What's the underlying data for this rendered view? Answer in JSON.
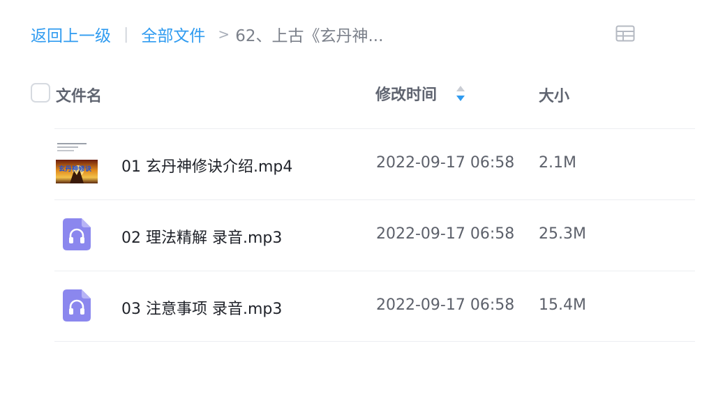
{
  "breadcrumb": {
    "back": "返回上一级",
    "divider": "|",
    "all_files": "全部文件",
    "arrow": ">",
    "current": "62、上古《玄丹神..."
  },
  "icons": {
    "view_toggle": "grid-view-icon",
    "sort": "sort-icon",
    "audio": "headphones-icon",
    "video_thumb": "video-thumbnail"
  },
  "colors": {
    "accent": "#2f9bf0",
    "audio_icon": "#8b87ee"
  },
  "header": {
    "name": "文件名",
    "time": "修改时间",
    "size": "大小"
  },
  "thumbnail": {
    "caption": "玄丹神修诀"
  },
  "files": [
    {
      "name": "01 玄丹神修诀介绍.mp4",
      "time": "2022-09-17 06:58",
      "size": "2.1M",
      "type": "video"
    },
    {
      "name": "02 理法精解 录音.mp3",
      "time": "2022-09-17 06:58",
      "size": "25.3M",
      "type": "audio"
    },
    {
      "name": "03 注意事项 录音.mp3",
      "time": "2022-09-17 06:58",
      "size": "15.4M",
      "type": "audio"
    }
  ]
}
